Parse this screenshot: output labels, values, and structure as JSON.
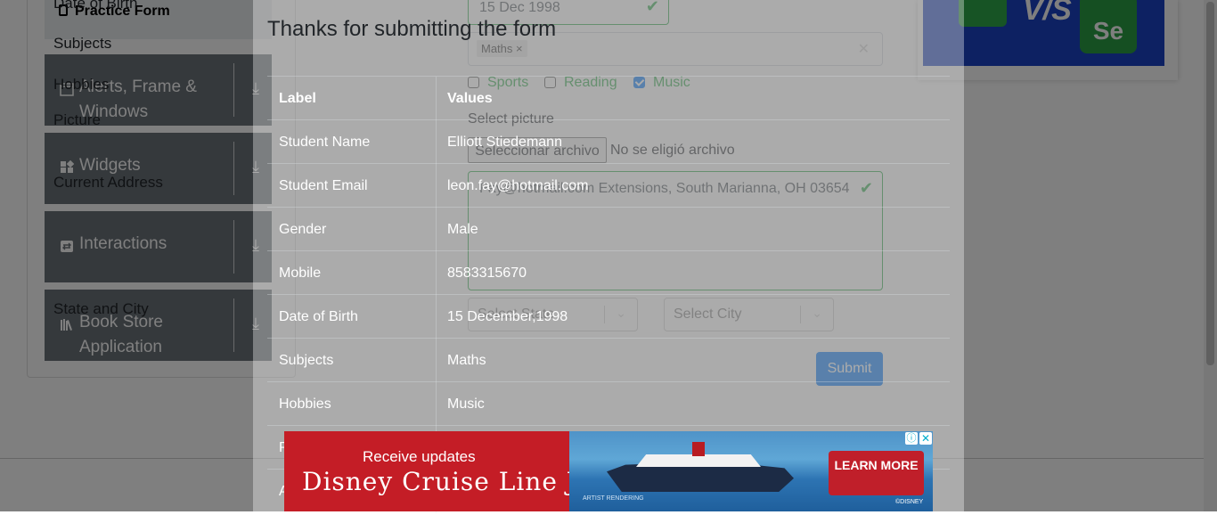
{
  "sidebar": {
    "active_item": "Practice Form",
    "groups": [
      {
        "label": "Alerts, Frame & Windows"
      },
      {
        "label": "Widgets"
      },
      {
        "label": "Interactions"
      },
      {
        "label": "Book Store Application"
      }
    ]
  },
  "form": {
    "dob_label": "Date of Birth",
    "dob_value": "15 Dec 1998",
    "subjects_label": "Subjects",
    "subject_tag": "Maths",
    "hobbies_label": "Hobbies",
    "hobbies": [
      {
        "label": "Sports",
        "checked": false
      },
      {
        "label": "Reading",
        "checked": false
      },
      {
        "label": "Music",
        "checked": true
      }
    ],
    "picture_label": "Picture",
    "picture_hint": "Select picture",
    "file_button": "Seleccionar archivo",
    "file_status": "No se eligió archivo",
    "address_label": "Current Address",
    "address_value": "Fay@hotmail.com Extensions, South Marianna, OH 03654",
    "state_city_label": "State and City",
    "state_placeholder": "Select State",
    "city_placeholder": "Select City",
    "submit_label": "Submit"
  },
  "modal": {
    "title": "Thanks for submitting the form",
    "header_label": "Label",
    "header_values": "Values",
    "rows": [
      {
        "label": "Student Name",
        "value": "Elliott Stiedemann"
      },
      {
        "label": "Student Email",
        "value": "leon.fay@hotmail.com"
      },
      {
        "label": "Gender",
        "value": "Male"
      },
      {
        "label": "Mobile",
        "value": "8583315670"
      },
      {
        "label": "Date of Birth",
        "value": "15 December,1998"
      },
      {
        "label": "Subjects",
        "value": "Maths"
      },
      {
        "label": "Hobbies",
        "value": "Music"
      },
      {
        "label": "P",
        "value": ""
      },
      {
        "label": "A",
        "value": ""
      }
    ]
  },
  "ad": {
    "line1": "Receive updates",
    "line2": "Disney Cruise Line JOBS",
    "cta": "LEARN MORE",
    "artist": "ARTIST RENDERING",
    "copyright": "©DISNEY"
  },
  "banner": {
    "text": "Se"
  },
  "colors": {
    "accent": "#007bff",
    "success": "#28a745",
    "sidebar": "#6b7279",
    "ad_red": "#c91e28"
  }
}
